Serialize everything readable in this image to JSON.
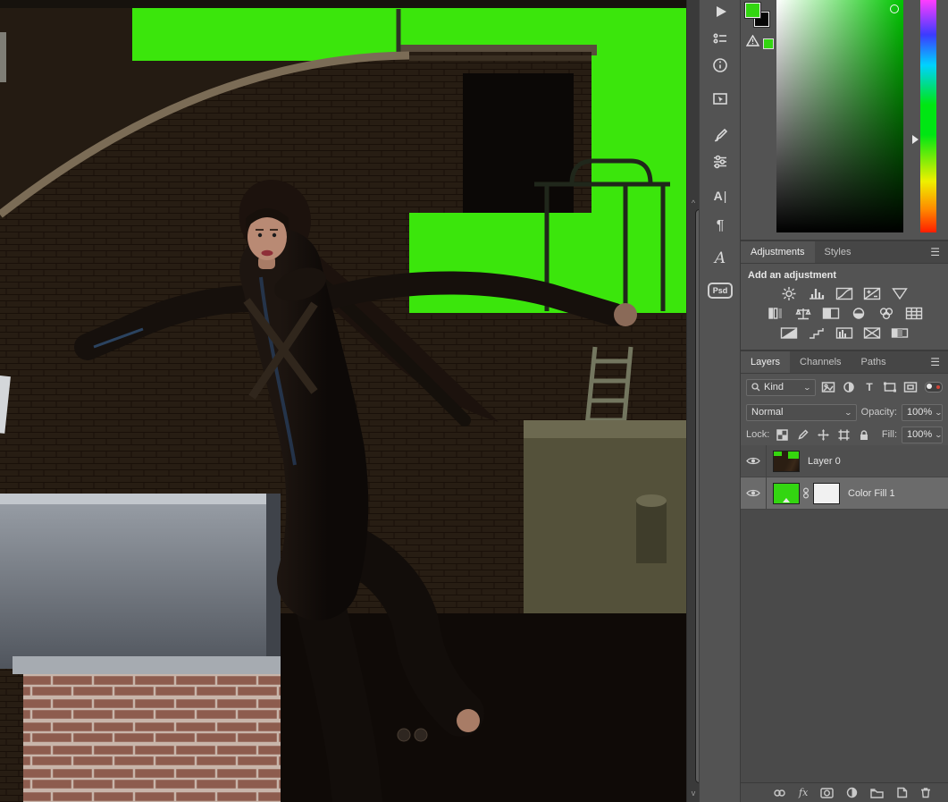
{
  "app": {
    "name": "Photoshop-style image editor",
    "theme": {
      "panel_bg": "#535353",
      "panel_dark": "#464646",
      "divider": "#3B3B3B",
      "selected_row": "#6B6B6B",
      "text": "#E0E0E0"
    }
  },
  "canvas": {
    "description": "3D render: dark-haired woman in a black leather outfit leaping from a brick rooftop against a green-screen sky; concrete ledge and brick chimney in foreground",
    "green_screen_color": "#3BE60C",
    "brick_color": "#271D13",
    "concrete_color": "#8A9098"
  },
  "dock": {
    "icons": [
      "actions",
      "tool-presets",
      "info",
      "navigator",
      "brush-settings",
      "properties",
      "character",
      "paragraph",
      "glyphs",
      "psd-badge"
    ],
    "psd_badge_text": "Psd"
  },
  "color_panel": {
    "foreground_color": "#33D611",
    "background_color": "#060606",
    "gamut_warning_swatch": "#33D611",
    "selected_hue": "green"
  },
  "adjustments_panel": {
    "tabs": [
      {
        "label": "Adjustments",
        "active": true
      },
      {
        "label": "Styles",
        "active": false
      }
    ],
    "add_label": "Add an adjustment",
    "icon_rows": [
      [
        "brightness-contrast",
        "levels",
        "curves",
        "exposure",
        "vibrance"
      ],
      [
        "hue-saturation",
        "color-balance",
        "black-white",
        "photo-filter",
        "channel-mixer",
        "color-lookup"
      ],
      [
        "invert",
        "posterize",
        "threshold",
        "selective-color",
        "gradient-map"
      ]
    ]
  },
  "layers_panel": {
    "tabs": [
      {
        "label": "Layers",
        "active": true
      },
      {
        "label": "Channels",
        "active": false
      },
      {
        "label": "Paths",
        "active": false
      }
    ],
    "filter": {
      "label": "Kind"
    },
    "blend_mode": "Normal",
    "opacity_label": "Opacity:",
    "opacity_value": "100%",
    "lock_label": "Lock:",
    "fill_label": "Fill:",
    "fill_value": "100%",
    "layers": [
      {
        "name": "Layer 0",
        "visible": true,
        "selected": false,
        "type": "image"
      },
      {
        "name": "Color Fill 1",
        "visible": true,
        "selected": true,
        "type": "solid-color-fill",
        "fill_color": "#33D611",
        "has_mask": true,
        "mask_linked": true
      }
    ],
    "bottom_bar": {
      "fx_label": "fx",
      "icons": [
        "link-layers",
        "layer-effects",
        "add-layer-mask",
        "new-adjustment-layer",
        "new-group",
        "new-layer",
        "delete-layer"
      ]
    }
  }
}
